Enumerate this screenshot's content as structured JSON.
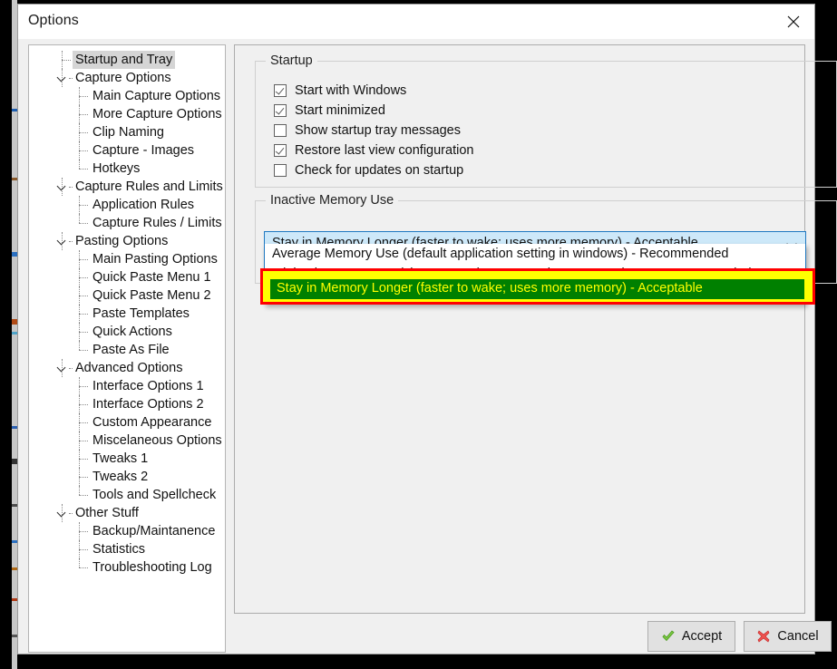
{
  "window": {
    "title": "Options",
    "close_icon": "close-x-icon"
  },
  "sidebar": {
    "items": [
      {
        "label": "Startup and Tray",
        "level": 0,
        "expandable": false,
        "selected": true
      },
      {
        "label": "Capture Options",
        "level": 0,
        "expandable": true,
        "selected": false
      },
      {
        "label": "Main Capture Options",
        "level": 1,
        "expandable": false,
        "selected": false
      },
      {
        "label": "More Capture Options",
        "level": 1,
        "expandable": false,
        "selected": false
      },
      {
        "label": "Clip Naming",
        "level": 1,
        "expandable": false,
        "selected": false
      },
      {
        "label": "Capture - Images",
        "level": 1,
        "expandable": false,
        "selected": false
      },
      {
        "label": "Hotkeys",
        "level": 1,
        "expandable": false,
        "selected": false
      },
      {
        "label": "Capture Rules and Limits",
        "level": 0,
        "expandable": true,
        "selected": false
      },
      {
        "label": "Application Rules",
        "level": 1,
        "expandable": false,
        "selected": false
      },
      {
        "label": "Capture Rules / Limits",
        "level": 1,
        "expandable": false,
        "selected": false
      },
      {
        "label": "Pasting Options",
        "level": 0,
        "expandable": true,
        "selected": false
      },
      {
        "label": "Main Pasting Options",
        "level": 1,
        "expandable": false,
        "selected": false
      },
      {
        "label": "Quick Paste Menu 1",
        "level": 1,
        "expandable": false,
        "selected": false
      },
      {
        "label": "Quick Paste Menu 2",
        "level": 1,
        "expandable": false,
        "selected": false
      },
      {
        "label": "Paste Templates",
        "level": 1,
        "expandable": false,
        "selected": false
      },
      {
        "label": "Quick Actions",
        "level": 1,
        "expandable": false,
        "selected": false
      },
      {
        "label": "Paste As File",
        "level": 1,
        "expandable": false,
        "selected": false
      },
      {
        "label": "Advanced Options",
        "level": 0,
        "expandable": true,
        "selected": false
      },
      {
        "label": "Interface Options 1",
        "level": 1,
        "expandable": false,
        "selected": false
      },
      {
        "label": "Interface Options 2",
        "level": 1,
        "expandable": false,
        "selected": false
      },
      {
        "label": "Custom Appearance",
        "level": 1,
        "expandable": false,
        "selected": false
      },
      {
        "label": "Miscelaneous Options",
        "level": 1,
        "expandable": false,
        "selected": false
      },
      {
        "label": "Tweaks 1",
        "level": 1,
        "expandable": false,
        "selected": false
      },
      {
        "label": "Tweaks 2",
        "level": 1,
        "expandable": false,
        "selected": false
      },
      {
        "label": "Tools and Spellcheck",
        "level": 1,
        "expandable": false,
        "selected": false
      },
      {
        "label": "Other Stuff",
        "level": 0,
        "expandable": true,
        "selected": false
      },
      {
        "label": "Backup/Maintanence",
        "level": 1,
        "expandable": false,
        "selected": false
      },
      {
        "label": "Statistics",
        "level": 1,
        "expandable": false,
        "selected": false
      },
      {
        "label": "Troubleshooting Log",
        "level": 1,
        "expandable": false,
        "selected": false
      }
    ]
  },
  "startup_group": {
    "title": "Startup",
    "checkboxes": [
      {
        "label": "Start with Windows",
        "checked": true
      },
      {
        "label": "Start minimized",
        "checked": true
      },
      {
        "label": "Show startup tray messages",
        "checked": false
      },
      {
        "label": "Restore last view configuration",
        "checked": true
      },
      {
        "label": "Check for updates on startup",
        "checked": false
      }
    ]
  },
  "memory_group": {
    "title": "Inactive Memory Use",
    "combo": {
      "value": "Stay in Memory Longer (faster to wake; uses more memory) - Acceptable",
      "arrow_icon": "chevron-down-icon"
    },
    "options": [
      "Average Memory Use (default application setting in windows) - Recommended",
      "Minimal Memory Use (slower to wake up; uses less memory) - Not Recommended",
      "Stay in Memory Longer (faster to wake; uses more memory) - Acceptable"
    ],
    "selected_option": "Stay in Memory Longer (faster to wake; uses more memory) - Acceptable",
    "annotation_colors": {
      "border": "#ff0000",
      "fill": "#ffff00",
      "selected_row": "#008000",
      "selected_text": "#ffff00"
    }
  },
  "footer": {
    "accept_label": "Accept",
    "accept_icon": "green-check-icon",
    "cancel_label": "Cancel",
    "cancel_icon": "red-x-icon"
  }
}
